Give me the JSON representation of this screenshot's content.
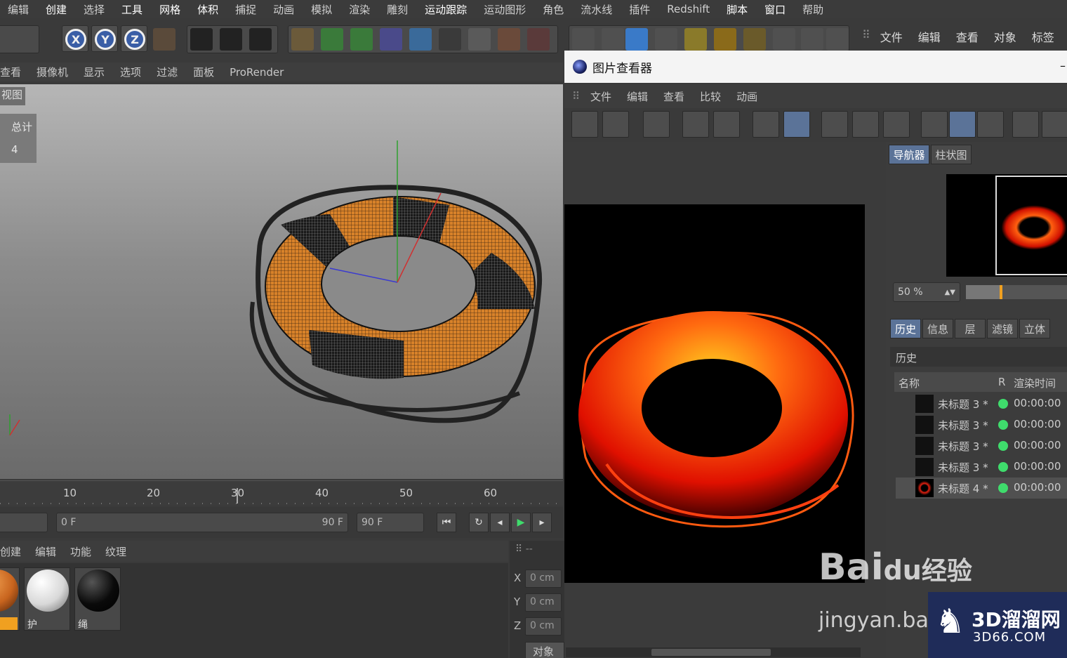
{
  "menubar": {
    "items": [
      "编辑",
      "创建",
      "选择",
      "工具",
      "网格",
      "体积",
      "捕捉",
      "动画",
      "模拟",
      "渲染",
      "雕刻",
      "运动跟踪",
      "运动图形",
      "角色",
      "流水线",
      "插件",
      "Redshift",
      "脚本",
      "窗口",
      "帮助"
    ]
  },
  "axes": {
    "x": "X",
    "y": "Y",
    "z": "Z"
  },
  "right_menu": {
    "items": [
      "文件",
      "编辑",
      "查看",
      "对象",
      "标签"
    ]
  },
  "viewport_menu": {
    "items": [
      "查看",
      "摄像机",
      "显示",
      "选项",
      "过滤",
      "面板",
      "ProRender"
    ]
  },
  "viewport": {
    "label": "视图",
    "stats_label": "总计",
    "stats_value": "4"
  },
  "timeline": {
    "ticks": [
      "10",
      "20",
      "30",
      "40",
      "50",
      "60"
    ]
  },
  "controls": {
    "start_frame": "0 F",
    "end_frame": "90 F",
    "end_frame_field": "90 F"
  },
  "material_menu": {
    "items": [
      "创建",
      "编辑",
      "功能",
      "纹理"
    ]
  },
  "materials": [
    {
      "label": "",
      "color": "#c8641e"
    },
    {
      "label": "护",
      "color": "#e8e8e8"
    },
    {
      "label": "绳",
      "color": "#0a0a0a"
    }
  ],
  "coords": {
    "header": "--",
    "x_label": "X",
    "x_value": "0 cm",
    "y_label": "Y",
    "y_value": "0 cm",
    "z_label": "Z",
    "z_value": "0 cm",
    "button": "对象"
  },
  "viewer": {
    "title": "图片查看器",
    "menu": [
      "文件",
      "编辑",
      "查看",
      "比较",
      "动画"
    ],
    "tabs_top": [
      "导航器",
      "柱状图"
    ],
    "zoom": "50 %",
    "tabs_bottom": [
      "历史",
      "信息",
      "层",
      "滤镜",
      "立体"
    ],
    "history_title": "历史",
    "columns": {
      "name": "名称",
      "r": "R",
      "time": "渲染时间"
    },
    "rows": [
      {
        "name": "未标题 3 *",
        "time": "00:00:00"
      },
      {
        "name": "未标题 3 *",
        "time": "00:00:00"
      },
      {
        "name": "未标题 3 *",
        "time": "00:00:00"
      },
      {
        "name": "未标题 3 *",
        "time": "00:00:00"
      },
      {
        "name": "未标题 4 *",
        "time": "00:00:00"
      }
    ]
  },
  "watermark": {
    "brand": "Bai",
    "brand2": "du",
    "brand3": "经验",
    "url": "jingyan.ba",
    "site": "3D溜溜网",
    "site_url": "3D66.COM"
  }
}
